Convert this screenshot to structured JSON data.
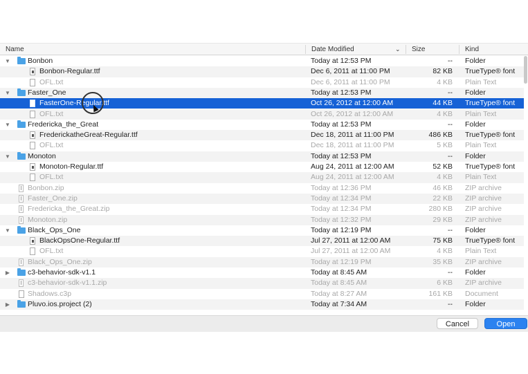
{
  "header": {
    "name": "Name",
    "date": "Date Modified",
    "size": "Size",
    "kind": "Kind"
  },
  "rows": [
    {
      "name": "Bonbon",
      "date": "Today at 12:53 PM",
      "size": "--",
      "kind": "Folder",
      "type": "folder",
      "indent": 0,
      "disclosure": "open"
    },
    {
      "name": "Bonbon-Regular.ttf",
      "date": "Dec 6, 2011 at 11:00 PM",
      "size": "82 KB",
      "kind": "TrueType® font",
      "type": "font",
      "indent": 1
    },
    {
      "name": "OFL.txt",
      "date": "Dec 6, 2011 at 11:00 PM",
      "size": "4 KB",
      "kind": "Plain Text",
      "type": "text",
      "indent": 1,
      "dim": true
    },
    {
      "name": "Faster_One",
      "date": "Today at 12:53 PM",
      "size": "--",
      "kind": "Folder",
      "type": "folder",
      "indent": 0,
      "disclosure": "open"
    },
    {
      "name": "FasterOne-Regular.ttf",
      "date": "Oct 26, 2012 at 12:00 AM",
      "size": "44 KB",
      "kind": "TrueType® font",
      "type": "font",
      "indent": 1,
      "selected": true
    },
    {
      "name": "OFL.txt",
      "date": "Oct 26, 2012 at 12:00 AM",
      "size": "4 KB",
      "kind": "Plain Text",
      "type": "text",
      "indent": 1,
      "dim": true
    },
    {
      "name": "Fredericka_the_Great",
      "date": "Today at 12:53 PM",
      "size": "--",
      "kind": "Folder",
      "type": "folder",
      "indent": 0,
      "disclosure": "open"
    },
    {
      "name": "FrederickatheGreat-Regular.ttf",
      "date": "Dec 18, 2011 at 11:00 PM",
      "size": "486 KB",
      "kind": "TrueType® font",
      "type": "font",
      "indent": 1
    },
    {
      "name": "OFL.txt",
      "date": "Dec 18, 2011 at 11:00 PM",
      "size": "5 KB",
      "kind": "Plain Text",
      "type": "text",
      "indent": 1,
      "dim": true
    },
    {
      "name": "Monoton",
      "date": "Today at 12:53 PM",
      "size": "--",
      "kind": "Folder",
      "type": "folder",
      "indent": 0,
      "disclosure": "open"
    },
    {
      "name": "Monoton-Regular.ttf",
      "date": "Aug 24, 2011 at 12:00 AM",
      "size": "52 KB",
      "kind": "TrueType® font",
      "type": "font",
      "indent": 1
    },
    {
      "name": "OFL.txt",
      "date": "Aug 24, 2011 at 12:00 AM",
      "size": "4 KB",
      "kind": "Plain Text",
      "type": "text",
      "indent": 1,
      "dim": true
    },
    {
      "name": "Bonbon.zip",
      "date": "Today at 12:36 PM",
      "size": "46 KB",
      "kind": "ZIP archive",
      "type": "zip",
      "indent": 0,
      "dim": true
    },
    {
      "name": "Faster_One.zip",
      "date": "Today at 12:34 PM",
      "size": "22 KB",
      "kind": "ZIP archive",
      "type": "zip",
      "indent": 0,
      "dim": true
    },
    {
      "name": "Fredericka_the_Great.zip",
      "date": "Today at 12:34 PM",
      "size": "280 KB",
      "kind": "ZIP archive",
      "type": "zip",
      "indent": 0,
      "dim": true
    },
    {
      "name": "Monoton.zip",
      "date": "Today at 12:32 PM",
      "size": "29 KB",
      "kind": "ZIP archive",
      "type": "zip",
      "indent": 0,
      "dim": true
    },
    {
      "name": "Black_Ops_One",
      "date": "Today at 12:19 PM",
      "size": "--",
      "kind": "Folder",
      "type": "folder",
      "indent": 0,
      "disclosure": "open"
    },
    {
      "name": "BlackOpsOne-Regular.ttf",
      "date": "Jul 27, 2011 at 12:00 AM",
      "size": "75 KB",
      "kind": "TrueType® font",
      "type": "font",
      "indent": 1
    },
    {
      "name": "OFL.txt",
      "date": "Jul 27, 2011 at 12:00 AM",
      "size": "4 KB",
      "kind": "Plain Text",
      "type": "text",
      "indent": 1,
      "dim": true
    },
    {
      "name": "Black_Ops_One.zip",
      "date": "Today at 12:19 PM",
      "size": "35 KB",
      "kind": "ZIP archive",
      "type": "zip",
      "indent": 0,
      "dim": true
    },
    {
      "name": "c3-behavior-sdk-v1.1",
      "date": "Today at 8:45 AM",
      "size": "--",
      "kind": "Folder",
      "type": "folder",
      "indent": 0,
      "disclosure": "closed"
    },
    {
      "name": "c3-behavior-sdk-v1.1.zip",
      "date": "Today at 8:45 AM",
      "size": "6 KB",
      "kind": "ZIP archive",
      "type": "zip",
      "indent": 0,
      "dim": true
    },
    {
      "name": "Shadows.c3p",
      "date": "Today at 8:27 AM",
      "size": "161 KB",
      "kind": "Document",
      "type": "doc",
      "indent": 0,
      "dim": true
    },
    {
      "name": "Pluvo.ios.project (2)",
      "date": "Today at 7:34 AM",
      "size": "--",
      "kind": "Folder",
      "type": "folder",
      "indent": 0,
      "disclosure": "closed"
    }
  ],
  "footer": {
    "cancel": "Cancel",
    "open": "Open"
  }
}
